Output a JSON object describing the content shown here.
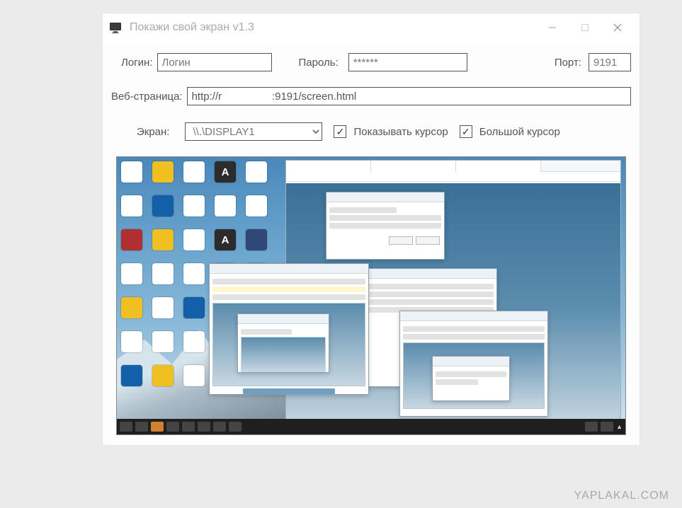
{
  "window": {
    "title": "Покажи свой экран v1.3"
  },
  "form": {
    "login_label": "Логин:",
    "login_value": "Логин",
    "password_label": "Пароль:",
    "password_value": "******",
    "port_label": "Порт:",
    "port_value": "9191",
    "url_label": "Веб-страница:",
    "url_value": "http://r                 :9191/screen.html",
    "screen_label": "Экран:",
    "screen_value": "\\\\.\\DISPLAY1",
    "show_cursor_label": "Показывать курсор",
    "big_cursor_label": "Большой курсор",
    "show_cursor_checked": true,
    "big_cursor_checked": true
  },
  "watermark": "YAPLAKAL.COM"
}
